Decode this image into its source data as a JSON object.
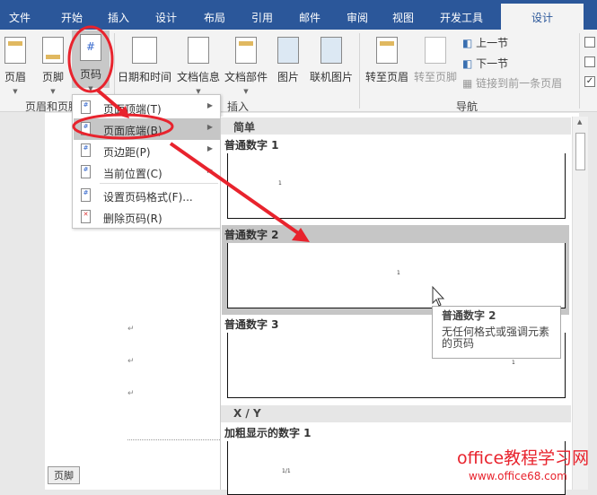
{
  "tabs": [
    "文件",
    "开始",
    "插入",
    "设计",
    "布局",
    "引用",
    "邮件",
    "审阅",
    "视图",
    "开发工具"
  ],
  "active_tab": "设计",
  "ribbon": {
    "header_label": "页眉",
    "footer_label": "页脚",
    "page_number_label": "页码",
    "date_time_label": "日期和时间",
    "doc_info_label": "文档信息",
    "quick_parts_label": "文档部件",
    "pictures_label": "图片",
    "online_pictures_label": "联机图片",
    "goto_header_label": "转至页眉",
    "goto_footer_label": "转至页脚",
    "prev_section_label": "上一节",
    "next_section_label": "下一节",
    "link_prev_label": "链接到前一条页眉",
    "group_header_footer": "页眉和页脚",
    "group_insert": "插入",
    "group_nav": "导航"
  },
  "menu": {
    "items": [
      {
        "label": "页面顶端(T)",
        "submenu": true
      },
      {
        "label": "页面底端(B)",
        "submenu": true
      },
      {
        "label": "页边距(P)",
        "submenu": true
      },
      {
        "label": "当前位置(C)",
        "submenu": true
      },
      {
        "label": "设置页码格式(F)...",
        "submenu": false
      },
      {
        "label": "删除页码(R)",
        "submenu": false
      }
    ]
  },
  "gallery": {
    "section_simple": "简单",
    "items": [
      {
        "title": "普通数字 1",
        "preview": "1"
      },
      {
        "title": "普通数字 2",
        "preview": "1"
      },
      {
        "title": "普通数字 3",
        "preview": "1"
      }
    ],
    "section_xy": "X / Y",
    "bold_item": {
      "title": "加粗显示的数字 1",
      "preview": "1/1"
    }
  },
  "tooltip": {
    "title": "普通数字 2",
    "desc": "无任何格式或强调元素的页码"
  },
  "document": {
    "footer_tag": "页脚",
    "para_mark": "↵"
  },
  "watermark": {
    "line1": "office教程学习网",
    "line2": "www.office68.com"
  },
  "colors": {
    "tab_bar": "#2b579a",
    "annotation": "#e8232d"
  }
}
